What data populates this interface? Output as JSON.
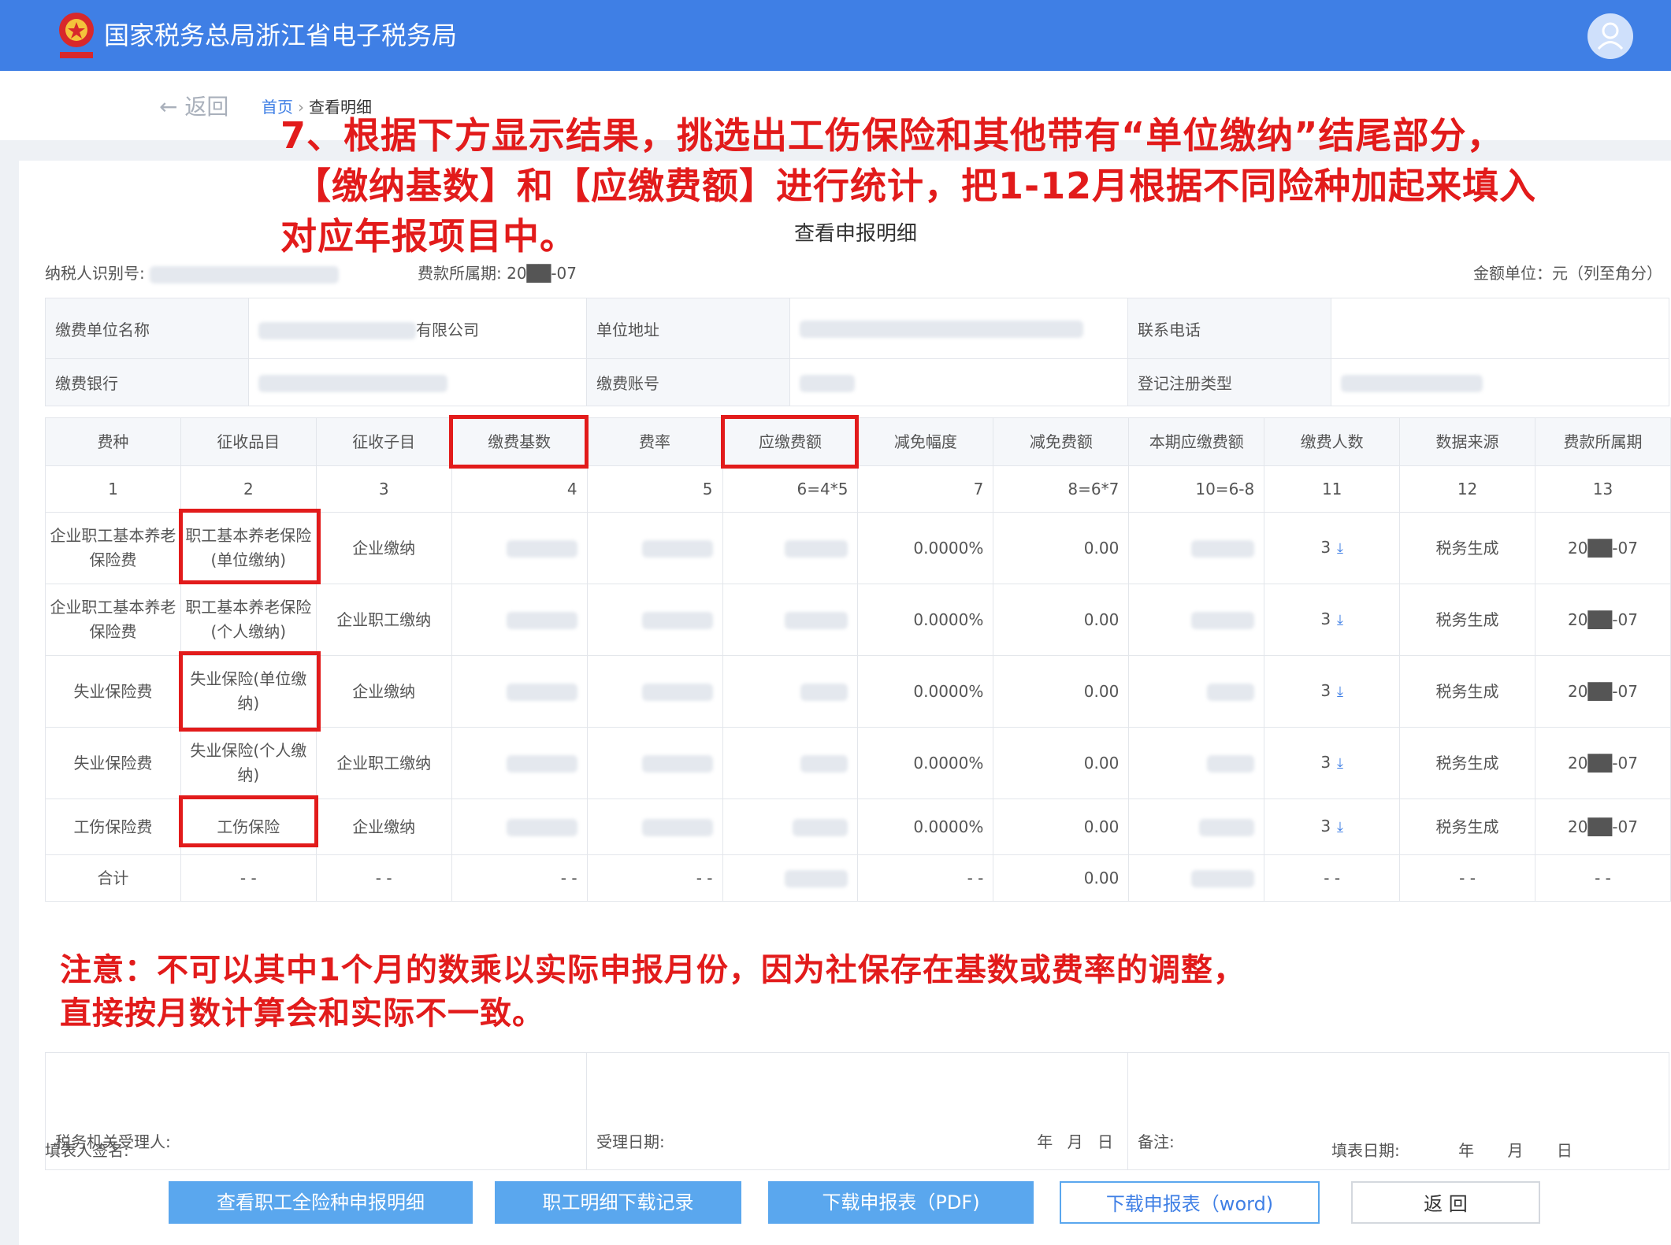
{
  "header": {
    "title": "国家税务总局浙江省电子税务局",
    "brand_color": "#3f7fe5"
  },
  "nav": {
    "back_label": "返回",
    "breadcrumb_home": "首页",
    "breadcrumb_current": "查看明细"
  },
  "annotation_top": {
    "line1": "7、根据下方显示结果，挑选出工伤保险和其他带有“单位缴纳”结尾部分，",
    "line2": "【缴纳基数】和【应缴费额】进行统计，把1-12月根据不同险种加起来填入",
    "line3": "对应年报项目中。"
  },
  "page_title": "查看申报明细",
  "meta": {
    "taxpayer_id_label": "纳税人识别号:",
    "period_label": "费款所属期:",
    "period_value": "20██-07",
    "unit_label": "金额单位：元（列至角分）"
  },
  "info": {
    "payer_name_label": "缴费单位名称",
    "payer_name_suffix": "有限公司",
    "address_label": "单位地址",
    "phone_label": "联系电话",
    "bank_label": "缴费银行",
    "account_label": "缴费账号",
    "reg_type_label": "登记注册类型"
  },
  "table": {
    "headers": [
      "费种",
      "征收品目",
      "征收子目",
      "缴费基数",
      "费率",
      "应缴费额",
      "减免幅度",
      "减免费额",
      "本期应缴费额",
      "缴费人数",
      "数据来源",
      "费款所属期"
    ],
    "index": [
      "1",
      "2",
      "3",
      "4",
      "5",
      "6=4*5",
      "7",
      "8=6*7",
      "10=6-8",
      "11",
      "12",
      "13"
    ],
    "rows": [
      {
        "fee": "企业职工基本养老保险费",
        "item": "职工基本养老保险(单位缴纳)",
        "sub": "企业缴纳",
        "reduce_rate": "0.0000%",
        "reduce_amt": "0.00",
        "count": "3",
        "source": "税务生成",
        "period": "20██-07"
      },
      {
        "fee": "企业职工基本养老保险费",
        "item": "职工基本养老保险(个人缴纳)",
        "sub": "企业职工缴纳",
        "reduce_rate": "0.0000%",
        "reduce_amt": "0.00",
        "count": "3",
        "source": "税务生成",
        "period": "20██-07"
      },
      {
        "fee": "失业保险费",
        "item": "失业保险(单位缴纳)",
        "sub": "企业缴纳",
        "reduce_rate": "0.0000%",
        "reduce_amt": "0.00",
        "count": "3",
        "source": "税务生成",
        "period": "20██-07"
      },
      {
        "fee": "失业保险费",
        "item": "失业保险(个人缴纳)",
        "sub": "企业职工缴纳",
        "reduce_rate": "0.0000%",
        "reduce_amt": "0.00",
        "count": "3",
        "source": "税务生成",
        "period": "20██-07"
      },
      {
        "fee": "工伤保险费",
        "item": "工伤保险",
        "sub": "企业缴纳",
        "reduce_rate": "0.0000%",
        "reduce_amt": "0.00",
        "count": "3",
        "source": "税务生成",
        "period": "20██-07"
      }
    ],
    "total": {
      "label": "合计",
      "dash": "- -",
      "reduce_amt": "0.00"
    }
  },
  "annotation_note": {
    "line1": "注意：不可以其中1个月的数乘以实际申报月份，因为社保存在基数或费率的调整，",
    "line2": "直接按月数计算会和实际不一致。"
  },
  "footer": {
    "handler_label": "税务机关受理人:",
    "accept_date_label": "受理日期:",
    "ymd": "年 月 日",
    "remark_label": "备注:",
    "filler_label": "填表人签名:",
    "fill_date_label": "填表日期:"
  },
  "buttons": {
    "detail": "查看职工全险种申报明细",
    "download_record": "职工明细下载记录",
    "pdf": "下载申报表（PDF)",
    "word": "下载申报表（word)",
    "back": "返 回"
  }
}
